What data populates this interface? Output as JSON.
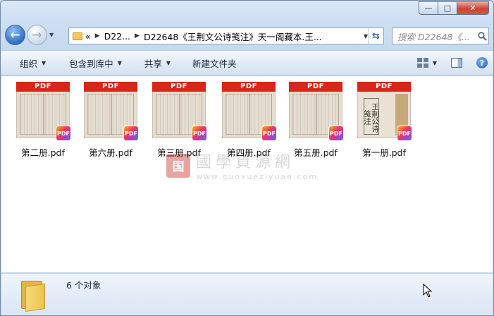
{
  "window": {
    "caption_buttons": {
      "minimize": "—",
      "maximize": "□",
      "close": "✕"
    }
  },
  "nav": {
    "back_icon": "back-arrow-icon",
    "forward_icon": "forward-arrow-icon"
  },
  "address": {
    "overflow": "«",
    "crumbs": [
      "D22...",
      "D22648《王荆文公诗笺注》天一阁藏本.王..."
    ]
  },
  "search": {
    "placeholder": "搜索 D22648《..."
  },
  "toolbar": {
    "organize": "组织",
    "include_in_library": "包含到库中",
    "share": "共享",
    "new_folder": "新建文件夹"
  },
  "files": [
    {
      "name": "第二册.pdf",
      "banner": "PDF",
      "badge": "PDF",
      "thumbnail": "page"
    },
    {
      "name": "第六册.pdf",
      "banner": "PDF",
      "badge": "PDF",
      "thumbnail": "page"
    },
    {
      "name": "第三册.pdf",
      "banner": "PDF",
      "badge": "PDF",
      "thumbnail": "page"
    },
    {
      "name": "第四册.pdf",
      "banner": "PDF",
      "badge": "PDF",
      "thumbnail": "page"
    },
    {
      "name": "第五册.pdf",
      "banner": "PDF",
      "badge": "PDF",
      "thumbnail": "page"
    },
    {
      "name": "第一册.pdf",
      "banner": "PDF",
      "badge": "PDF",
      "thumbnail": "cover",
      "cover_title": "王荆公诗笺注"
    }
  ],
  "watermark": {
    "seal": "国",
    "text": "國學資源網",
    "url": "www.guoxueziyuan.com"
  },
  "status": {
    "count": "6 个对象"
  },
  "colors": {
    "pdf_banner": "#d9251c",
    "window_frame": "#cddff2",
    "close_button": "#c8452e"
  }
}
